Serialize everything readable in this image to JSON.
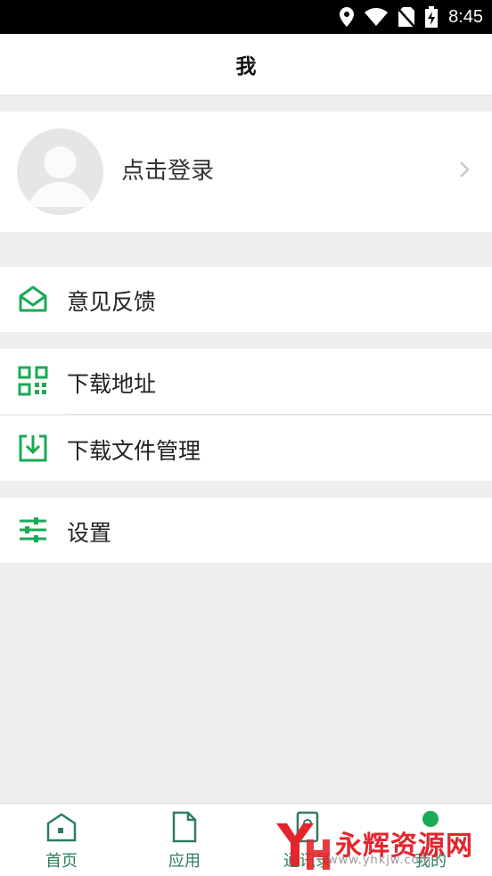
{
  "status": {
    "time": "8:45"
  },
  "header": {
    "title": "我"
  },
  "profile": {
    "login_text": "点击登录"
  },
  "menu": [
    {
      "label": "意见反馈",
      "icon": "mail-open-icon"
    },
    {
      "label": "下载地址",
      "icon": "qr-code-icon"
    },
    {
      "label": "下载文件管理",
      "icon": "download-tray-icon"
    },
    {
      "label": "设置",
      "icon": "sliders-icon"
    }
  ],
  "tabs": [
    {
      "label": "首页",
      "icon": "home-icon"
    },
    {
      "label": "应用",
      "icon": "file-icon"
    },
    {
      "label": "通讯录",
      "icon": "contacts-icon"
    },
    {
      "label": "我的",
      "icon": "profile-icon"
    }
  ],
  "watermark": {
    "brand": "永辉资源网",
    "url": "www.yhkjw.com"
  },
  "colors": {
    "accent": "#1aaa55",
    "tab_text": "#2e7d5b"
  }
}
